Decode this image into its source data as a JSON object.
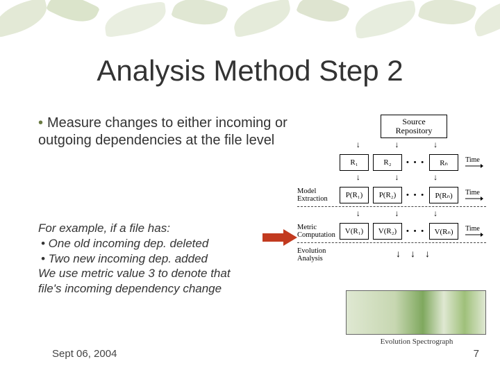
{
  "title": "Analysis Method Step 2",
  "bullet": "Measure changes to either incoming or outgoing dependencies at the file level",
  "example": {
    "lead": "For example, if a file has:",
    "i1": "• One old incoming dep. deleted",
    "i2": "• Two new incoming dep. added",
    "tail1": "We use metric value 3 to denote that",
    "tail2": "file's incoming dependency change"
  },
  "footer": {
    "date": "Sept 06, 2004",
    "page": "7"
  },
  "fig": {
    "repo": "Source Repository",
    "R": [
      "R₁",
      "R₂",
      "Rₙ"
    ],
    "P": [
      "P(R₁)",
      "P(R₂)",
      "P(Rₙ)"
    ],
    "V": [
      "V(R₁)",
      "V(R₂)",
      "V(Rₙ)"
    ],
    "labels": {
      "extract": "Model Extraction",
      "metric": "Metric Computation",
      "evo": "Evolution Analysis"
    },
    "dots": "• • •",
    "time": "Time",
    "spectro": "Evolution Spectrograph"
  }
}
